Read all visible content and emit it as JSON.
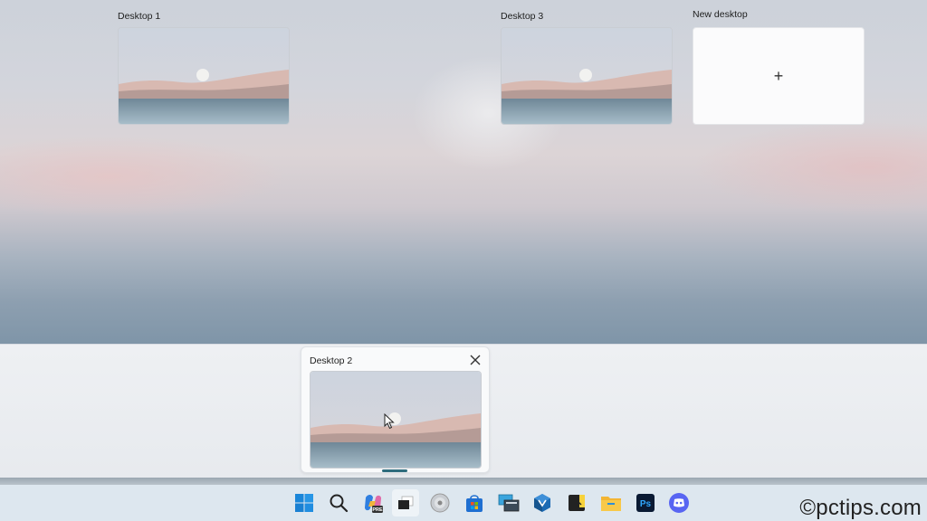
{
  "task_view": {
    "desktops": [
      {
        "label": "Desktop 1"
      },
      {
        "label": "Desktop 2"
      },
      {
        "label": "Desktop 3"
      }
    ],
    "new_desktop": {
      "label": "New desktop",
      "icon": "plus-icon",
      "symbol": "+"
    },
    "close_icon": "close-icon"
  },
  "taskbar": {
    "icons": [
      "windows-start-icon",
      "search-icon",
      "copilot-pre-icon",
      "task-view-icon",
      "disk-icon",
      "microsoft-store-icon",
      "virtual-desktop-icon",
      "virtualbox-icon",
      "sticky-notes-icon",
      "file-explorer-icon",
      "photoshop-icon",
      "discord-icon"
    ],
    "photoshop_label": "Ps"
  },
  "watermark": "©pctips.com",
  "colors": {
    "selection_indicator": "#2d6c7d",
    "taskbar_bg": "#dde7ef",
    "strip_bg": "#eef0f3"
  }
}
